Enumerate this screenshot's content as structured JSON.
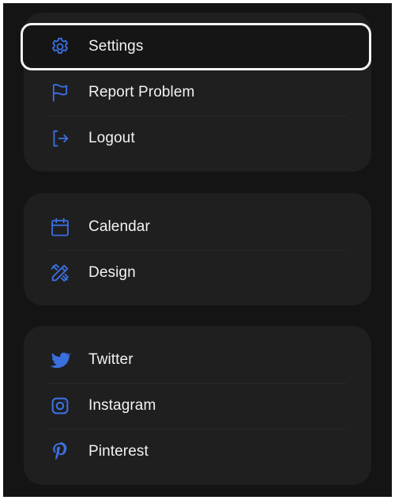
{
  "groups": [
    {
      "items": [
        {
          "label": "Settings",
          "icon": "gear-icon",
          "focused": true
        },
        {
          "label": "Report Problem",
          "icon": "flag-icon"
        },
        {
          "label": "Logout",
          "icon": "logout-icon"
        }
      ]
    },
    {
      "items": [
        {
          "label": "Calendar",
          "icon": "calendar-icon"
        },
        {
          "label": "Design",
          "icon": "pencil-ruler-icon"
        }
      ]
    },
    {
      "items": [
        {
          "label": "Twitter",
          "icon": "twitter-icon"
        },
        {
          "label": "Instagram",
          "icon": "instagram-icon"
        },
        {
          "label": "Pinterest",
          "icon": "pinterest-icon"
        }
      ]
    }
  ],
  "colors": {
    "background": "#141414",
    "card": "#1f1f1f",
    "icon_accent": "#3b6fe0",
    "text": "#f2f2f2",
    "focus_ring": "#f4f4f4"
  }
}
